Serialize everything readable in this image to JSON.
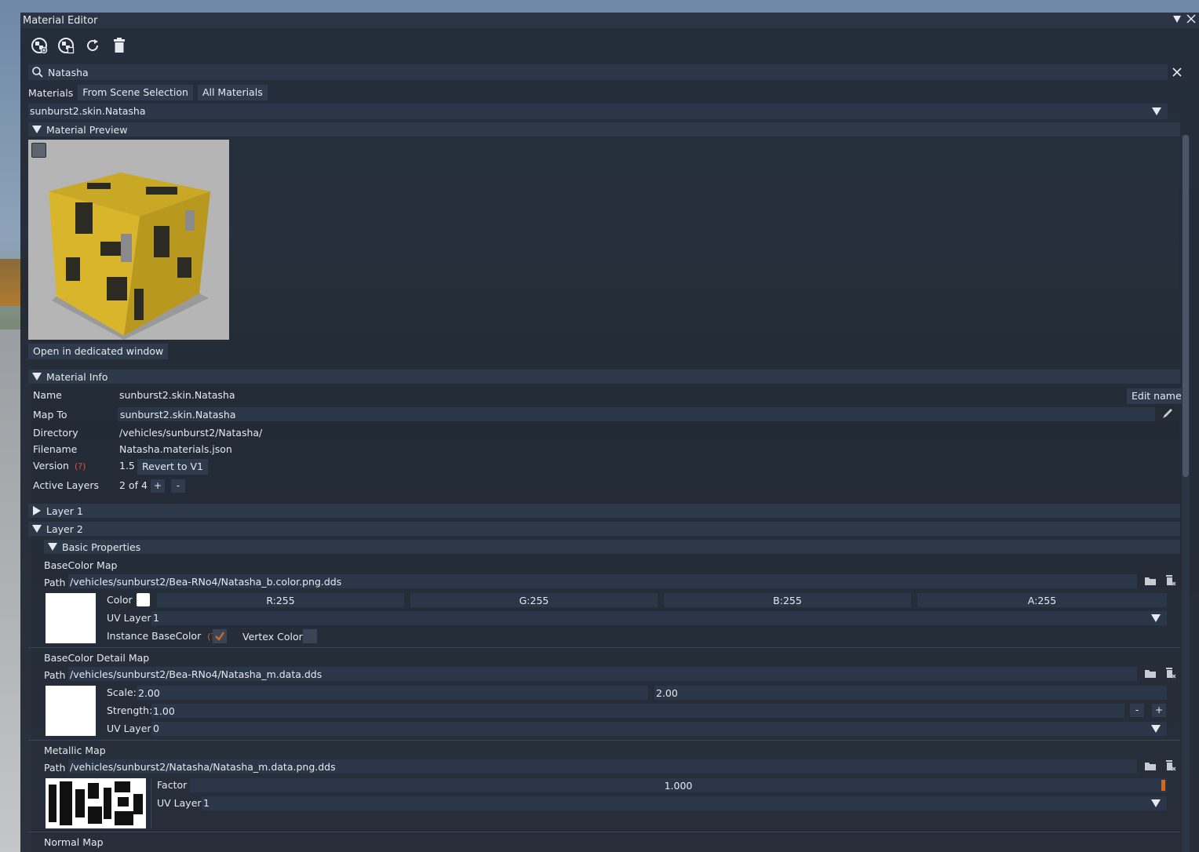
{
  "window": {
    "title": "Material Editor"
  },
  "search": {
    "value": "Natasha"
  },
  "materials": {
    "label": "Materials",
    "tabs": [
      "From Scene Selection",
      "All Materials"
    ],
    "selected": "sunburst2.skin.Natasha"
  },
  "preview": {
    "header": "Material Preview",
    "open_button": "Open in dedicated window"
  },
  "info": {
    "header": "Material Info",
    "name_label": "Name",
    "name_value": "sunburst2.skin.Natasha",
    "edit_name_button": "Edit name",
    "mapto_label": "Map To",
    "mapto_value": "sunburst2.skin.Natasha",
    "directory_label": "Directory",
    "directory_value": "/vehicles/sunburst2/Natasha/",
    "filename_label": "Filename",
    "filename_value": "Natasha.materials.json",
    "version_label": "Version",
    "version_help": "(?)",
    "version_value": "1.5",
    "revert_button": "Revert to V1",
    "active_label": "Active Layers",
    "active_value": "2 of 4",
    "plus": "+",
    "minus": "-"
  },
  "layers": {
    "layer1": "Layer 1",
    "layer2": "Layer 2",
    "basic_props": "Basic Properties"
  },
  "basecolor": {
    "title": "BaseColor Map",
    "path_label": "Path",
    "path": "/vehicles/sunburst2/Bea-RNo4/Natasha_b.color.png.dds",
    "color_label": "Color",
    "r": "R:255",
    "g": "G:255",
    "b": "B:255",
    "a": "A:255",
    "uv_label": "UV Layer",
    "uv_value": "1",
    "instance_label": "Instance BaseColor",
    "instance_help": "(?)",
    "vertex_label": "Vertex Color"
  },
  "detail": {
    "title": "BaseColor Detail Map",
    "path_label": "Path",
    "path": "/vehicles/sunburst2/Bea-RNo4/Natasha_m.data.dds",
    "scale_label": "Scale:",
    "scale_x": "2.00",
    "scale_y": "2.00",
    "strength_label": "Strength:",
    "strength_value": "1.00",
    "minus": "-",
    "plus": "+",
    "uv_label": "UV Layer",
    "uv_value": "0"
  },
  "metallic": {
    "title": "Metallic Map",
    "path_label": "Path",
    "path": "/vehicles/sunburst2/Natasha/Natasha_m.data.png.dds",
    "factor_label": "Factor",
    "factor_value": "1.000",
    "uv_label": "UV Layer",
    "uv_value": "1"
  },
  "normal": {
    "title": "Normal Map"
  },
  "colors": {
    "accent": "#d2691e",
    "help": "#e0524a",
    "panel": "#1e2632"
  }
}
